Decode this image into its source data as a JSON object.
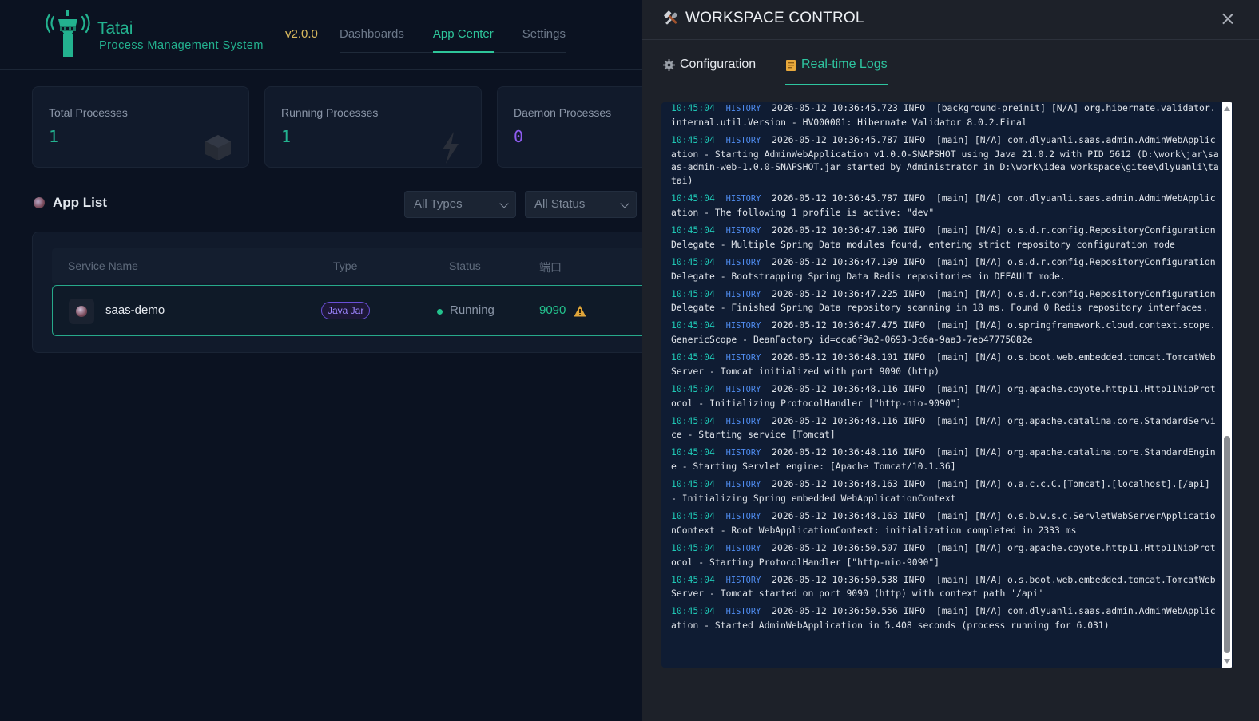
{
  "app": {
    "brand_name": "Tatai",
    "brand_subtitle": "Process Management System",
    "version": "v2.0.0",
    "nav": [
      {
        "label": "Dashboards",
        "active": false
      },
      {
        "label": "App Center",
        "active": true
      },
      {
        "label": "Settings",
        "active": false
      }
    ],
    "stats": [
      {
        "label": "Total Processes",
        "value": "1",
        "color": "#23b28f",
        "icon": "box-icon"
      },
      {
        "label": "Running Processes",
        "value": "1",
        "color": "#23b28f",
        "icon": "lightning-icon"
      },
      {
        "label": "Daemon Processes",
        "value": "0",
        "color": "#8e5cf0",
        "icon": ""
      }
    ],
    "section_title": "App List",
    "filters": {
      "type": "All Types",
      "status": "All Status"
    },
    "table": {
      "headers": [
        "Service Name",
        "Type",
        "Status",
        "端口"
      ],
      "rows": [
        {
          "name": "saas-demo",
          "type": "Java Jar",
          "status": "Running",
          "port": "9090"
        }
      ]
    }
  },
  "drawer": {
    "title": "WORKSPACE CONTROL",
    "tabs": [
      {
        "label": "Configuration",
        "icon": "gear-icon",
        "active": false
      },
      {
        "label": "Real-time Logs",
        "icon": "scroll-icon",
        "active": true
      }
    ],
    "logs": [
      {
        "time": "10:45:04",
        "tag": "HISTORY",
        "text": "2026-05-12 10:36:45.723 INFO  [background-preinit] [N/A] org.hibernate.validator.internal.util.Version - HV000001: Hibernate Validator 8.0.2.Final"
      },
      {
        "time": "10:45:04",
        "tag": "HISTORY",
        "text": "2026-05-12 10:36:45.787 INFO  [main] [N/A] com.dlyuanli.saas.admin.AdminWebApplication - Starting AdminWebApplication v1.0.0-SNAPSHOT using Java 21.0.2 with PID 5612 (D:\\work\\jar\\saas-admin-web-1.0.0-SNAPSHOT.jar started by Administrator in D:\\work\\idea_workspace\\gitee\\dlyuanli\\tatai)"
      },
      {
        "time": "10:45:04",
        "tag": "HISTORY",
        "text": "2026-05-12 10:36:45.787 INFO  [main] [N/A] com.dlyuanli.saas.admin.AdminWebApplication - The following 1 profile is active: \"dev\""
      },
      {
        "time": "10:45:04",
        "tag": "HISTORY",
        "text": "2026-05-12 10:36:47.196 INFO  [main] [N/A] o.s.d.r.config.RepositoryConfigurationDelegate - Multiple Spring Data modules found, entering strict repository configuration mode"
      },
      {
        "time": "10:45:04",
        "tag": "HISTORY",
        "text": "2026-05-12 10:36:47.199 INFO  [main] [N/A] o.s.d.r.config.RepositoryConfigurationDelegate - Bootstrapping Spring Data Redis repositories in DEFAULT mode."
      },
      {
        "time": "10:45:04",
        "tag": "HISTORY",
        "text": "2026-05-12 10:36:47.225 INFO  [main] [N/A] o.s.d.r.config.RepositoryConfigurationDelegate - Finished Spring Data repository scanning in 18 ms. Found 0 Redis repository interfaces."
      },
      {
        "time": "10:45:04",
        "tag": "HISTORY",
        "text": "2026-05-12 10:36:47.475 INFO  [main] [N/A] o.springframework.cloud.context.scope.GenericScope - BeanFactory id=cca6f9a2-0693-3c6a-9aa3-7eb47775082e"
      },
      {
        "time": "10:45:04",
        "tag": "HISTORY",
        "text": "2026-05-12 10:36:48.101 INFO  [main] [N/A] o.s.boot.web.embedded.tomcat.TomcatWebServer - Tomcat initialized with port 9090 (http)"
      },
      {
        "time": "10:45:04",
        "tag": "HISTORY",
        "text": "2026-05-12 10:36:48.116 INFO  [main] [N/A] org.apache.coyote.http11.Http11NioProtocol - Initializing ProtocolHandler [\"http-nio-9090\"]"
      },
      {
        "time": "10:45:04",
        "tag": "HISTORY",
        "text": "2026-05-12 10:36:48.116 INFO  [main] [N/A] org.apache.catalina.core.StandardService - Starting service [Tomcat]"
      },
      {
        "time": "10:45:04",
        "tag": "HISTORY",
        "text": "2026-05-12 10:36:48.116 INFO  [main] [N/A] org.apache.catalina.core.StandardEngine - Starting Servlet engine: [Apache Tomcat/10.1.36]"
      },
      {
        "time": "10:45:04",
        "tag": "HISTORY",
        "text": "2026-05-12 10:36:48.163 INFO  [main] [N/A] o.a.c.c.C.[Tomcat].[localhost].[/api] - Initializing Spring embedded WebApplicationContext"
      },
      {
        "time": "10:45:04",
        "tag": "HISTORY",
        "text": "2026-05-12 10:36:48.163 INFO  [main] [N/A] o.s.b.w.s.c.ServletWebServerApplicationContext - Root WebApplicationContext: initialization completed in 2333 ms"
      },
      {
        "time": "10:45:04",
        "tag": "HISTORY",
        "text": "2026-05-12 10:36:50.507 INFO  [main] [N/A] org.apache.coyote.http11.Http11NioProtocol - Starting ProtocolHandler [\"http-nio-9090\"]"
      },
      {
        "time": "10:45:04",
        "tag": "HISTORY",
        "text": "2026-05-12 10:36:50.538 INFO  [main] [N/A] o.s.boot.web.embedded.tomcat.TomcatWebServer - Tomcat started on port 9090 (http) with context path '/api'"
      },
      {
        "time": "10:45:04",
        "tag": "HISTORY",
        "text": "2026-05-12 10:36:50.556 INFO  [main] [N/A] com.dlyuanli.saas.admin.AdminWebApplication - Started AdminWebApplication in 5.408 seconds (process running for 6.031)"
      }
    ]
  }
}
